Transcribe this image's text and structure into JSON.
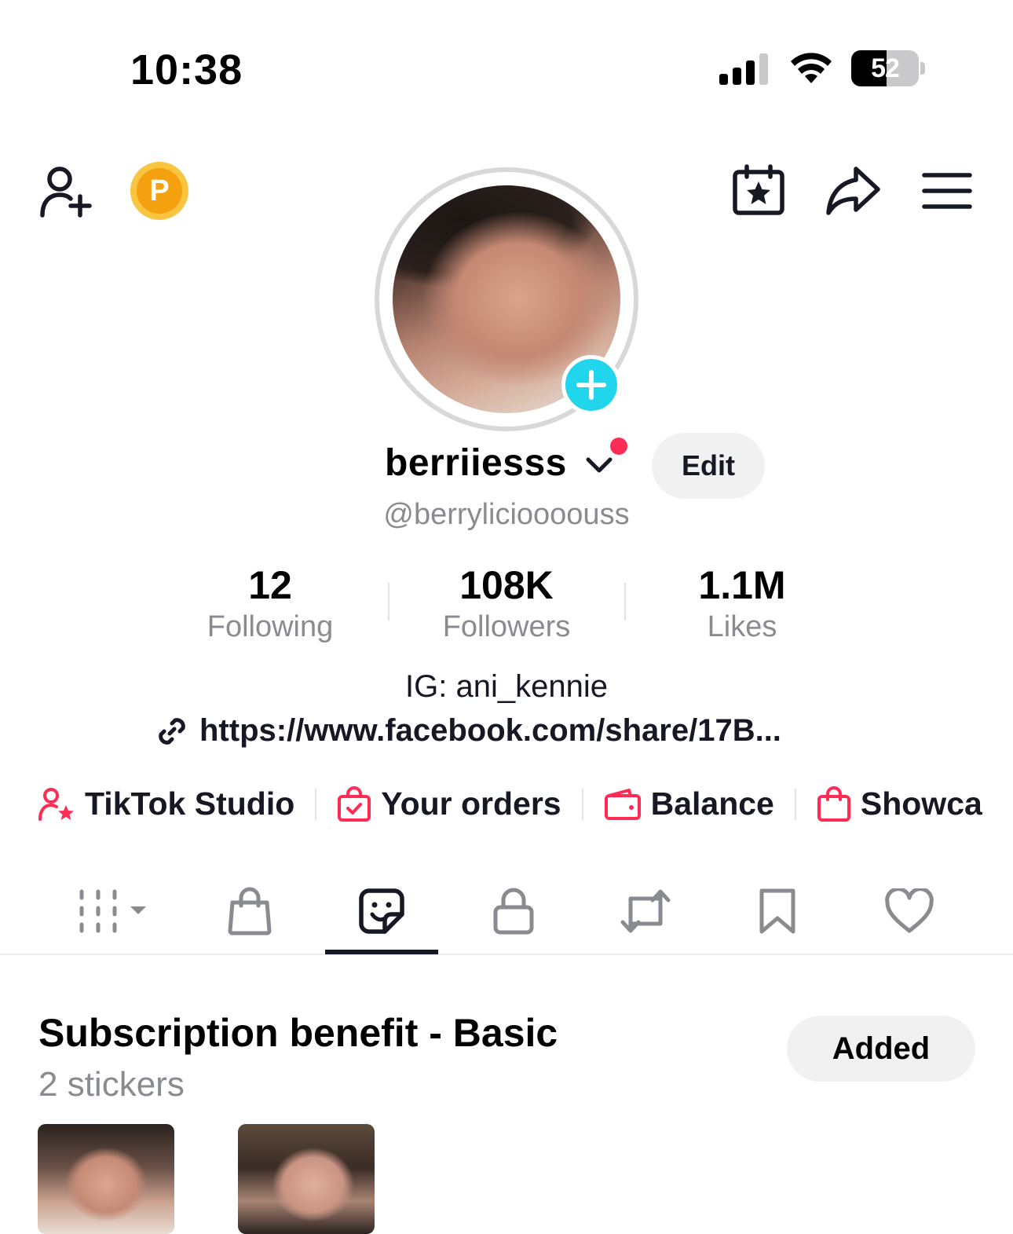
{
  "status_bar": {
    "time": "10:38",
    "battery": "52",
    "battery_level": 0.52
  },
  "header": {
    "icons": [
      "add-user-icon",
      "points-coin-icon",
      "calendar-star-icon",
      "share-icon",
      "menu-icon"
    ],
    "coin_letter": "P"
  },
  "profile": {
    "username": "berriiesss",
    "handle": "@berrylicioooouss",
    "edit_label": "Edit",
    "stats": [
      {
        "value": "12",
        "label": "Following"
      },
      {
        "value": "108K",
        "label": "Followers"
      },
      {
        "value": "1.1M",
        "label": "Likes"
      }
    ],
    "bio": "IG: ani_kennie",
    "link": "https://www.facebook.com/share/17B..."
  },
  "shortcuts": [
    {
      "label": "TikTok Studio",
      "icon": "user-star-icon"
    },
    {
      "label": "Your orders",
      "icon": "order-bag-icon"
    },
    {
      "label": "Balance",
      "icon": "wallet-icon"
    },
    {
      "label": "Showca",
      "icon": "shopping-bag-icon"
    }
  ],
  "tabs": [
    "videos-grid-icon",
    "shop-bag-icon",
    "sticker-icon",
    "lock-icon",
    "repost-icon",
    "bookmark-icon",
    "heart-icon"
  ],
  "active_tab": "sticker-icon",
  "subscription": {
    "title": "Subscription benefit - Basic",
    "count": "2 stickers",
    "button": "Added"
  },
  "colors": {
    "accent": "#fe2c55",
    "cyan": "#20d5ec",
    "coin": "#f5a00e"
  }
}
